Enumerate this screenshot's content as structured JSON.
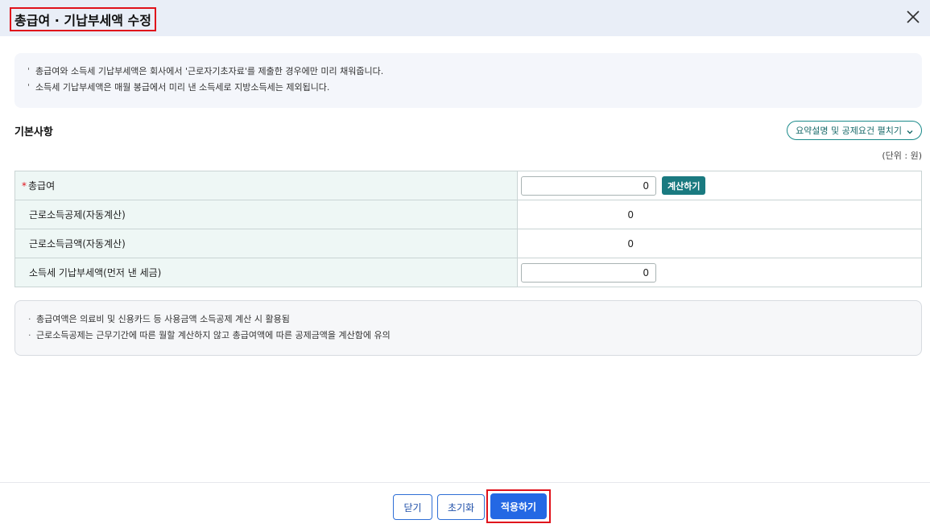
{
  "dialog": {
    "title": "총급여 · 기납부세액 수정",
    "close_icon": "close-icon"
  },
  "notice": {
    "lines": [
      "총급여와 소득세 기납부세액은 회사에서 '근로자기초자료'를 제출한 경우에만 미리 채워줍니다.",
      "소득세 기납부세액은 매월 봉급에서 미리 낸 소득세로 지방소득세는 제외됩니다."
    ],
    "marker": "'"
  },
  "section": {
    "title": "기본사항",
    "summary_button": "요약설명 및 공제요건 펼치기",
    "unit": "(단위 : 원)"
  },
  "table": {
    "required_mark": "*",
    "rows": [
      {
        "label": "총급여",
        "value": "0",
        "type": "input",
        "button": "계산하기"
      },
      {
        "label": "근로소득공제(자동계산)",
        "value": "0",
        "type": "static"
      },
      {
        "label": "근로소득금액(자동계산)",
        "value": "0",
        "type": "static"
      },
      {
        "label": "소득세 기납부세액(먼저 낸 세금)",
        "value": "0",
        "type": "input"
      }
    ]
  },
  "info": {
    "marker": "·",
    "lines": [
      "총급여액은 의료비 및 신용카드 등 사용금액 소득공제 계산 시 활용됨",
      "근로소득공제는 근무기간에 따른 월할 계산하지 않고 총급여액에 따른 공제금액을 계산함에 유의"
    ]
  },
  "footer": {
    "close_label": "닫기",
    "reset_label": "초기화",
    "apply_label": "적용하기"
  },
  "colors": {
    "header_bg": "#e9eef7",
    "highlight": "#e0121b",
    "primary": "#2468e4",
    "teal": "#1a7a80",
    "label_bg": "#eef7f5"
  }
}
